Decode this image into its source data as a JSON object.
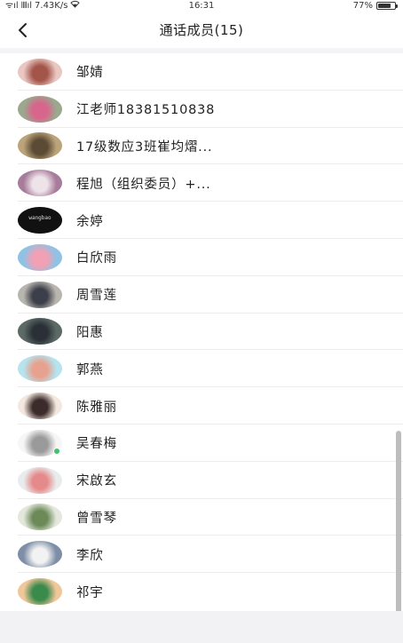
{
  "status_bar": {
    "carrier": "ᯤıl 𝍬ıl",
    "speed": "7.43K/s",
    "time": "16:31",
    "battery_text": "77%",
    "battery_level": 0.77
  },
  "header": {
    "title": "通话成员(15)"
  },
  "members": [
    {
      "name": "邹婧",
      "avatar_bg": "#e9c7c2",
      "avatar_fg": "#a3554a",
      "avatar_text": ""
    },
    {
      "name": "江老师18381510838",
      "avatar_bg": "#9aa88e",
      "avatar_fg": "#d8668c",
      "avatar_text": ""
    },
    {
      "name": "17级数应3班崔均熠...",
      "avatar_bg": "#bba37a",
      "avatar_fg": "#5b4a34",
      "avatar_text": ""
    },
    {
      "name": "程旭（组织委员）+...",
      "avatar_bg": "#a77c9a",
      "avatar_fg": "#efe3ea",
      "avatar_text": ""
    },
    {
      "name": "余婷",
      "avatar_bg": "#111111",
      "avatar_fg": "#cccccc",
      "avatar_text": "wangbao"
    },
    {
      "name": "白欣雨",
      "avatar_bg": "#8ec3e6",
      "avatar_fg": "#f2a0b4",
      "avatar_text": ""
    },
    {
      "name": "周雪莲",
      "avatar_bg": "#b9b6b0",
      "avatar_fg": "#3c3f49",
      "avatar_text": ""
    },
    {
      "name": "阳惠",
      "avatar_bg": "#5c6a66",
      "avatar_fg": "#2a3036",
      "avatar_text": ""
    },
    {
      "name": "郭燕",
      "avatar_bg": "#b5e3ee",
      "avatar_fg": "#e7a28f",
      "avatar_text": ""
    },
    {
      "name": "陈雅丽",
      "avatar_bg": "#f3e7de",
      "avatar_fg": "#3b2b2b",
      "avatar_text": ""
    },
    {
      "name": "吴春梅",
      "avatar_bg": "#f6f6f6",
      "avatar_fg": "#9a9a9a",
      "avatar_text": "",
      "badge": true
    },
    {
      "name": "宋啟玄",
      "avatar_bg": "#e9eced",
      "avatar_fg": "#e58a8a",
      "avatar_text": ""
    },
    {
      "name": "曾雪琴",
      "avatar_bg": "#e4e8dc",
      "avatar_fg": "#6b8a58",
      "avatar_text": ""
    },
    {
      "name": "李欣",
      "avatar_bg": "#7d8ea6",
      "avatar_fg": "#f2f2f2",
      "avatar_text": ""
    },
    {
      "name": "祁宇",
      "avatar_bg": "#f1c79a",
      "avatar_fg": "#3a8a4c",
      "avatar_text": ""
    }
  ]
}
